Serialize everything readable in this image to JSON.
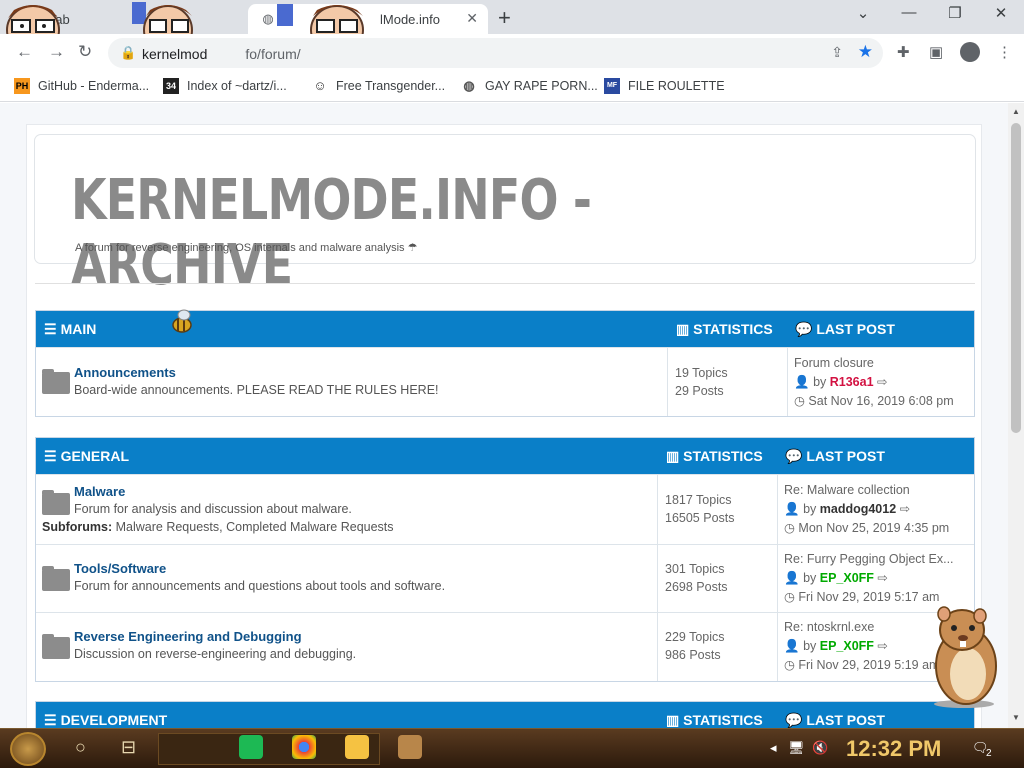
{
  "browser": {
    "tabs": [
      {
        "label": "w Tab"
      },
      {
        "label": ""
      },
      {
        "label": "lMode.info"
      }
    ],
    "new_tab_glyph": "+",
    "window_controls": {
      "minimize": "⌄",
      "minimize2": "—",
      "restore": "❐",
      "close": "✕"
    },
    "url": {
      "host": "kernelmode.",
      "rest": "fo/forum/"
    },
    "url_display": "kernelmod",
    "url_path": "fo/forum/"
  },
  "bookmarks": [
    {
      "icon": "PH",
      "label": "GitHub - Enderma..."
    },
    {
      "icon": "34",
      "label": "Index of ~dartz/i..."
    },
    {
      "icon": "☺",
      "label": "Free Transgender..."
    },
    {
      "icon": "◍",
      "label": "GAY RAPE PORN..."
    },
    {
      "icon": "MF",
      "label": "FILE ROULETTE"
    }
  ],
  "site": {
    "title": "KERNELMODE.INFO - ARCHIVE",
    "description": "A forum for reverse engineering, OS internals and malware analysis ☂"
  },
  "sections": [
    {
      "title": "MAIN",
      "stats_label": "STATISTICS",
      "last_label": "LAST POST",
      "forums": [
        {
          "name": "Announcements",
          "description": "Board-wide announcements. PLEASE READ THE RULES HERE!",
          "topics": "19 Topics",
          "posts": "29 Posts",
          "last_title": "Forum closure",
          "last_user": "R136a1",
          "last_date": "Sat Nov 16, 2019 6:08 pm"
        }
      ]
    },
    {
      "title": "GENERAL",
      "stats_label": "STATISTICS",
      "last_label": "LAST POST",
      "forums": [
        {
          "name": "Malware",
          "description": "Forum for analysis and discussion about malware.",
          "subforums_label": "Subforums:",
          "subforums": "Malware Requests, Completed Malware Requests",
          "topics": "1817 Topics",
          "posts": "16505 Posts",
          "last_title": "Re: Malware collection",
          "last_user": "maddog4012",
          "last_date": "Mon Nov 25, 2019 4:35 pm"
        },
        {
          "name": "Tools/Software",
          "description": "Forum for announcements and questions about tools and software.",
          "topics": "301 Topics",
          "posts": "2698 Posts",
          "last_title": "Re: Furry Pegging Object Ex...",
          "last_user": "EP_X0FF",
          "last_date": "Fri Nov 29, 2019 5:17 am"
        },
        {
          "name": "Reverse Engineering and Debugging",
          "description": "Discussion on reverse-engineering and debugging.",
          "topics": "229 Topics",
          "posts": "986 Posts",
          "last_title": "Re: ntoskrnl.exe",
          "last_user": "EP_X0FF",
          "last_date": "Fri Nov 29, 2019 5:19 am"
        }
      ]
    },
    {
      "title": "DEVELOPMENT",
      "stats_label": "STATISTICS",
      "last_label": "LAST POST",
      "forums": []
    }
  ],
  "by_label": "by",
  "taskbar": {
    "time": "12:32 PM",
    "notification_count": "2"
  },
  "colors": {
    "header_blue": "#0a7fc8",
    "link_blue": "#105289",
    "user_red": "#d31141",
    "user_green": "#00aa00",
    "taskbar_brown": "#4a2e16",
    "clock_gold": "#f0c869"
  }
}
